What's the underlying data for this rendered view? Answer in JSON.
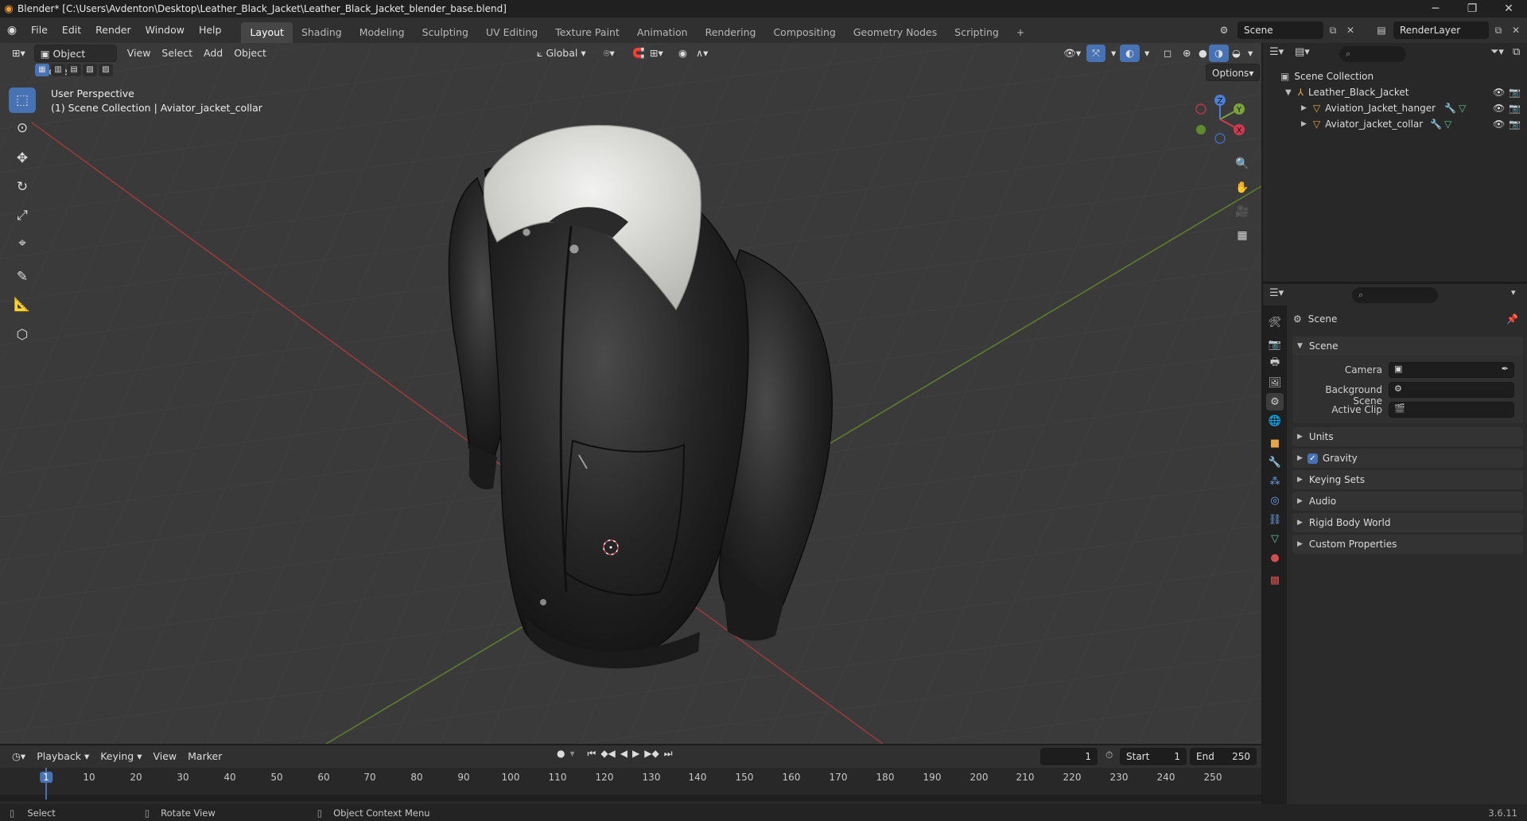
{
  "window": {
    "title": "Blender* [C:\\Users\\Avdenton\\Desktop\\Leather_Black_Jacket\\Leather_Black_Jacket_blender_base.blend]",
    "minimize": "─",
    "maximize": "❐",
    "close": "✕"
  },
  "menu": {
    "items": [
      "File",
      "Edit",
      "Render",
      "Window",
      "Help"
    ],
    "workspaces": [
      "Layout",
      "Shading",
      "Modeling",
      "Sculpting",
      "UV Editing",
      "Texture Paint",
      "Animation",
      "Rendering",
      "Compositing",
      "Geometry Nodes",
      "Scripting"
    ],
    "active_workspace": "Layout",
    "add_workspace": "+",
    "scene": "Scene",
    "render_layer": "RenderLayer"
  },
  "viewport": {
    "mode": "Object Mode",
    "menus": [
      "View",
      "Select",
      "Add",
      "Object"
    ],
    "orientation": "Global",
    "options": "Options",
    "overlay_line1": "User Perspective",
    "overlay_line2": "(1) Scene Collection | Aviator_jacket_collar",
    "gizmo": {
      "z": "Z",
      "y": "Y",
      "x": "X"
    }
  },
  "outliner": {
    "root": "Scene Collection",
    "collection": "Leather_Black_Jacket",
    "objects": [
      "Aviation_Jacket_hanger",
      "Aviator_jacket_collar"
    ]
  },
  "properties": {
    "context": "Scene",
    "panel_title": "Scene",
    "fields": [
      {
        "label": "Camera",
        "value": ""
      },
      {
        "label": "Background Scene",
        "value": ""
      },
      {
        "label": "Active Clip",
        "value": ""
      }
    ],
    "panels": [
      "Units",
      "Gravity",
      "Keying Sets",
      "Audio",
      "Rigid Body World",
      "Custom Properties"
    ],
    "gravity_checked": true
  },
  "timeline": {
    "menus": [
      "Playback",
      "Keying",
      "View",
      "Marker"
    ],
    "current_frame": "1",
    "start_label": "Start",
    "start": "1",
    "end_label": "End",
    "end": "250",
    "ticks": [
      "1",
      "10",
      "20",
      "30",
      "40",
      "50",
      "60",
      "70",
      "80",
      "90",
      "100",
      "110",
      "120",
      "130",
      "140",
      "150",
      "160",
      "170",
      "180",
      "190",
      "200",
      "210",
      "220",
      "230",
      "240",
      "250"
    ]
  },
  "statusbar": {
    "select": "Select",
    "rotate": "Rotate View",
    "context_menu": "Object Context Menu",
    "version": "3.6.11"
  }
}
